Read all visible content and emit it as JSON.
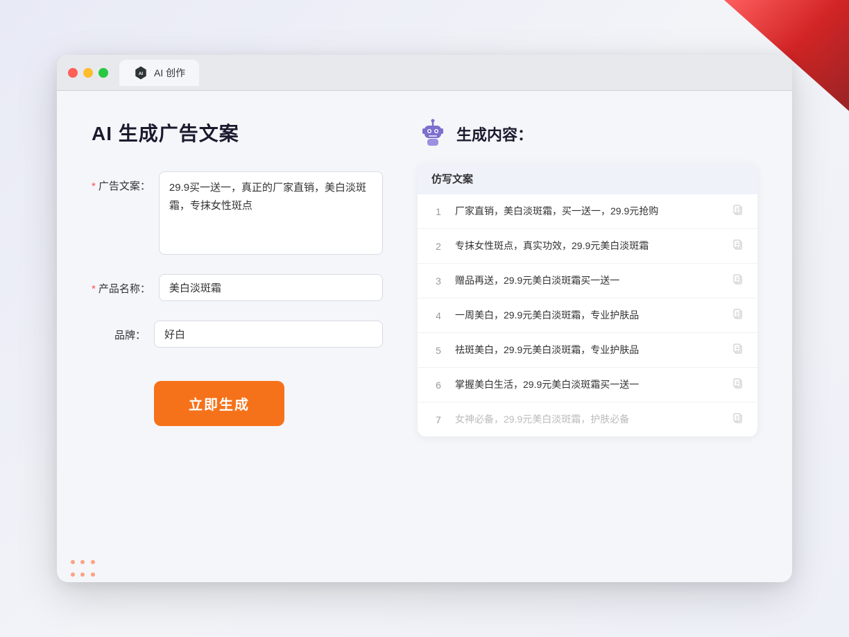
{
  "browser": {
    "tab_label": "AI 创作"
  },
  "page": {
    "title": "AI 生成广告文案",
    "results_title": "生成内容："
  },
  "form": {
    "ad_copy_label": "广告文案：",
    "ad_copy_required": "*",
    "ad_copy_value": "29.9买一送一，真正的厂家直销，美白淡斑霜，专抹女性斑点",
    "product_name_label": "产品名称：",
    "product_name_required": "*",
    "product_name_value": "美白淡斑霜",
    "brand_label": "品牌：",
    "brand_value": "好白",
    "generate_button": "立即生成"
  },
  "results": {
    "column_header": "仿写文案",
    "items": [
      {
        "num": "1",
        "text": "厂家直销，美白淡斑霜，买一送一，29.9元抢购",
        "muted": false
      },
      {
        "num": "2",
        "text": "专抹女性斑点，真实功效，29.9元美白淡斑霜",
        "muted": false
      },
      {
        "num": "3",
        "text": "赠品再送，29.9元美白淡斑霜买一送一",
        "muted": false
      },
      {
        "num": "4",
        "text": "一周美白，29.9元美白淡斑霜，专业护肤品",
        "muted": false
      },
      {
        "num": "5",
        "text": "祛斑美白，29.9元美白淡斑霜，专业护肤品",
        "muted": false
      },
      {
        "num": "6",
        "text": "掌握美白生活，29.9元美白淡斑霜买一送一",
        "muted": false
      },
      {
        "num": "7",
        "text": "女神必备，29.9元美白淡斑霜，护肤必备",
        "muted": true
      }
    ]
  },
  "colors": {
    "accent_orange": "#f5721a",
    "brand_purple": "#6c5ce7",
    "required_red": "#ff4d4f"
  }
}
